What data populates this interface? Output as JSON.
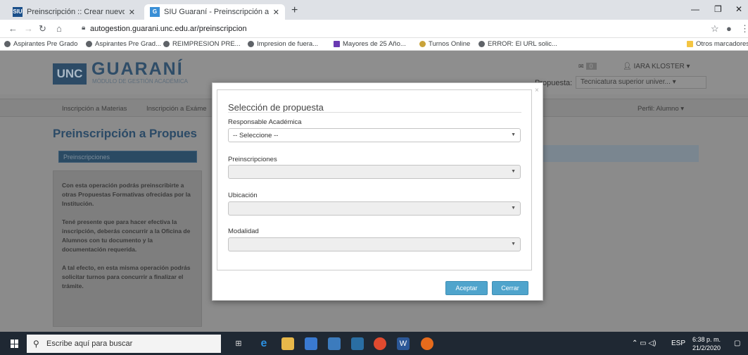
{
  "browser": {
    "tabs": [
      {
        "title": "Preinscripción :: Crear nuevo usu",
        "favicon": "siu-favicon",
        "active": false
      },
      {
        "title": "SIU Guaraní - Preinscripción a Pr",
        "favicon": "guarani-favicon",
        "active": true
      }
    ],
    "url": "autogestion.guarani.unc.edu.ar/preinscripcion",
    "bookmarks": [
      "Aspirantes Pre Grado",
      "Aspirantes Pre Grad...",
      "REIMPRESION PRE...",
      "Impresion de fuera...",
      "Mayores de 25 Año...",
      "Turnos Online",
      "ERROR: El URL solic..."
    ],
    "other_bookmarks": "Otros marcadores"
  },
  "app": {
    "logo_unc": "UNC",
    "logo_title": "GUARANÍ",
    "logo_subtitle": "MÓDULO DE GESTIÓN ACADÉMICA",
    "mail_count": "0",
    "user_name": "IARA KLOSTER ▾",
    "propuesta_label": "Propuesta:",
    "propuesta_value": "Tecnicatura superior univer...",
    "menu": [
      "Inscripción a Materias",
      "Inscripción a Exáme",
      "Perfil: Alumno ▾"
    ],
    "heading": "Preinscripción a Propues",
    "side_tab": "Preinscripciones",
    "info": [
      "Con esta operación podrás preinscribirte a otras Propuestas Formativas ofrecidas por la Institución.",
      "Tené presente que para hacer efectiva la inscripción, deberás concurrir a la Oficina de Alumnos con tu documento y la documentación requerida.",
      "A tal efecto, en esta misma operación podrás solicitar turnos para concurrir a finalizar el trámite."
    ]
  },
  "modal": {
    "title": "Selección de propuesta",
    "close": "×",
    "fields": [
      {
        "label": "Responsable Académica",
        "value": "-- Seleccione --",
        "disabled": false
      },
      {
        "label": "Preinscripciones",
        "value": "",
        "disabled": true
      },
      {
        "label": "Ubicación",
        "value": "",
        "disabled": true
      },
      {
        "label": "Modalidad",
        "value": "",
        "disabled": true
      }
    ],
    "accept_label": "Aceptar",
    "close_label": "Cerrar"
  },
  "taskbar": {
    "search_placeholder": "Escribe aquí para buscar",
    "language": "ESP",
    "time": "6:38 p. m.",
    "date": "21/2/2020"
  },
  "colors": {
    "accent": "#4fa4cc",
    "brand": "#2b4a66",
    "overlay_bg": "#8b8b8b"
  }
}
